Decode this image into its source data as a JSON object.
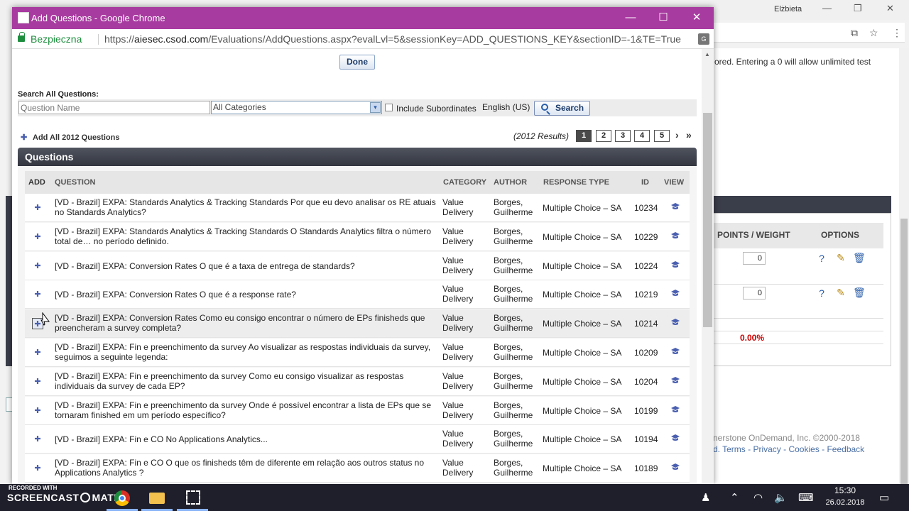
{
  "background_window": {
    "user_name": "Elżbieta",
    "note_text": "ored. Entering a 0 will allow unlimited test",
    "columns": [
      "POINTS / WEIGHT",
      "OPTIONS"
    ],
    "point_values": [
      "0",
      "0"
    ],
    "percent_total": "0.00%",
    "footer_line1": "nerstone OnDemand, Inc. ©2000-2018",
    "footer_line2": "d.  Terms - Privacy - Cookies - Feedback"
  },
  "popup": {
    "window_title": "Add Questions - Google Chrome",
    "secure_label": "Bezpieczna",
    "url_scheme": "https://",
    "url_host": "aiesec.csod.com",
    "url_path": "/Evaluations/AddQuestions.aspx?evalLvl=5&sessionKey=ADD_QUESTIONS_KEY&sectionID=-1&TE=True",
    "done_label": "Done",
    "search": {
      "label": "Search All Questions:",
      "question_placeholder": "Question Name",
      "category_value": "All Categories",
      "include_subordinates_label": "Include Subordinates",
      "language": "English (US)",
      "button_label": "Search"
    },
    "add_all_label": "Add All 2012 Questions",
    "results_text": "(2012 Results)",
    "pages": [
      "1",
      "2",
      "3",
      "4",
      "5"
    ],
    "active_page": "1",
    "panel_title": "Questions",
    "columns": {
      "add": "ADD",
      "question": "QUESTION",
      "category": "CATEGORY",
      "author": "AUTHOR",
      "response_type": "RESPONSE TYPE",
      "id": "ID",
      "view": "VIEW"
    },
    "rows": [
      {
        "question": "[VD - Brazil] EXPA: Standards Analytics & Tracking Standards Por que eu devo analisar os RE atuais no Standards Analytics?",
        "category": "Value Delivery",
        "author": "Borges, Guilherme",
        "response_type": "Multiple Choice – SA",
        "id": "10234"
      },
      {
        "question": "[VD - Brazil] EXPA: Standards Analytics & Tracking Standards O Standards Analytics filtra o número total de… no período definido.",
        "category": "Value Delivery",
        "author": "Borges, Guilherme",
        "response_type": "Multiple Choice – SA",
        "id": "10229"
      },
      {
        "question": "[VD - Brazil] EXPA: Conversion Rates O que é a taxa de entrega de standards?",
        "category": "Value Delivery",
        "author": "Borges, Guilherme",
        "response_type": "Multiple Choice – SA",
        "id": "10224"
      },
      {
        "question": "[VD - Brazil] EXPA: Conversion Rates O que é a response rate?",
        "category": "Value Delivery",
        "author": "Borges, Guilherme",
        "response_type": "Multiple Choice – SA",
        "id": "10219"
      },
      {
        "question": "[VD - Brazil] EXPA: Conversion Rates Como eu consigo encontrar o número de EPs finisheds que preencheram a survey completa?",
        "category": "Value Delivery",
        "author": "Borges, Guilherme",
        "response_type": "Multiple Choice – SA",
        "id": "10214"
      },
      {
        "question": "[VD - Brazil] EXPA: Fin e preenchimento da survey Ao visualizar as respostas individuais da survey, seguimos a seguinte legenda:",
        "category": "Value Delivery",
        "author": "Borges, Guilherme",
        "response_type": "Multiple Choice – SA",
        "id": "10209"
      },
      {
        "question": "[VD - Brazil] EXPA: Fin e preenchimento da survey Como eu consigo visualizar as respostas individuais da survey de cada EP?",
        "category": "Value Delivery",
        "author": "Borges, Guilherme",
        "response_type": "Multiple Choice – SA",
        "id": "10204"
      },
      {
        "question": "[VD - Brazil] EXPA: Fin e preenchimento da survey Onde é possível encontrar a lista de EPs que se tornaram finished em um período específico?",
        "category": "Value Delivery",
        "author": "Borges, Guilherme",
        "response_type": "Multiple Choice – SA",
        "id": "10199"
      },
      {
        "question": "[VD - Brazil] EXPA: Fin e CO No Applications Analytics...",
        "category": "Value Delivery",
        "author": "Borges, Guilherme",
        "response_type": "Multiple Choice – SA",
        "id": "10194"
      },
      {
        "question": "[VD - Brazil] EXPA: Fin e CO O que os finisheds têm de diferente em relação aos outros status no Applications Analytics ?",
        "category": "Value Delivery",
        "author": "Borges, Guilherme",
        "response_type": "Multiple Choice – SA",
        "id": "10189"
      }
    ]
  },
  "taskbar": {
    "recorder_line1": "RECORDED WITH",
    "recorder_line2a": "SCREENCAST",
    "recorder_line2b": "MATIC",
    "time": "15:30",
    "date": "26.02.2018"
  },
  "colors": {
    "popup_titlebar": "#a83ba0",
    "panel_header": "#3a3d4a",
    "secure_green": "#1e8e3e",
    "percent_red": "#cc0000",
    "taskbar": "#1f1f2b"
  }
}
